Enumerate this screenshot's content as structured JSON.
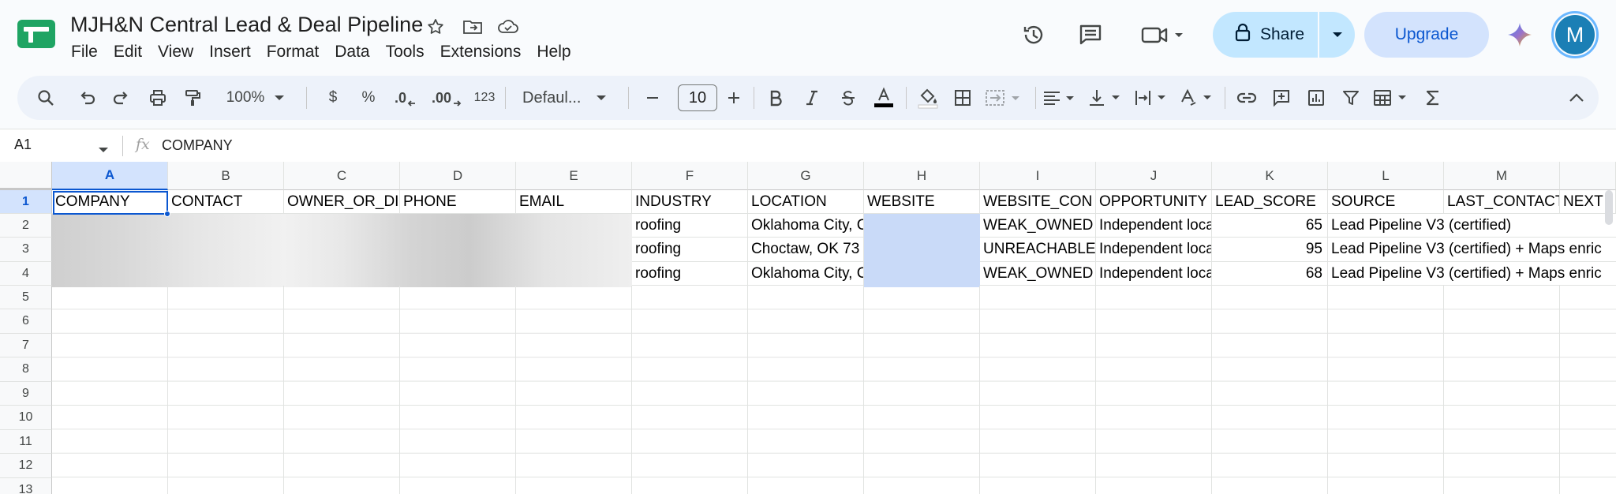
{
  "app": {
    "title": "MJH&N Central Lead & Deal Pipeline",
    "menu": [
      "File",
      "Edit",
      "View",
      "Insert",
      "Format",
      "Data",
      "Tools",
      "Extensions",
      "Help"
    ],
    "share_label": "Share",
    "upgrade_label": "Upgrade",
    "avatar_letter": "M"
  },
  "toolbar": {
    "zoom": "100%",
    "currency": "$",
    "percent": "%",
    "decrease_decimal": ".0",
    "increase_decimal": ".00",
    "number_format": "123",
    "font": "Defaul...",
    "font_size": "10"
  },
  "formula_bar": {
    "cell_ref": "A1",
    "fx": "fx",
    "content": "COMPANY"
  },
  "sheet": {
    "columns": [
      "A",
      "B",
      "C",
      "D",
      "E",
      "F",
      "G",
      "H",
      "I",
      "J",
      "K",
      "L",
      "M"
    ],
    "row_numbers": [
      "1",
      "2",
      "3",
      "4",
      "5",
      "6",
      "7",
      "8",
      "9",
      "10",
      "11",
      "12",
      "13"
    ],
    "header_row": [
      "COMPANY",
      "CONTACT",
      "OWNER_OR_DI",
      "PHONE",
      "EMAIL",
      "INDUSTRY",
      "LOCATION",
      "WEBSITE",
      "WEBSITE_CON",
      "OPPORTUNITY",
      "LEAD_SCORE",
      "SOURCE",
      "LAST_CONTACT",
      "NEXT"
    ],
    "rows": [
      {
        "industry": "roofing",
        "location": "Oklahoma City, C",
        "website_con": "WEAK_OWNED",
        "opportunity": "Independent loca",
        "lead_score": "65",
        "source": "Lead Pipeline V3 (certified)"
      },
      {
        "industry": "roofing",
        "location": "Choctaw, OK 73",
        "website_con": "UNREACHABLE",
        "opportunity": "Independent loca",
        "lead_score": "95",
        "source": "Lead Pipeline V3 (certified) + Maps enric"
      },
      {
        "industry": "roofing",
        "location": "Oklahoma City, C",
        "website_con": "WEAK_OWNED",
        "opportunity": "Independent loca",
        "lead_score": "68",
        "source": "Lead Pipeline V3 (certified) + Maps enric"
      }
    ]
  },
  "colors": {
    "accent": "#0b57d0",
    "share_bg": "#c2e7ff",
    "upgrade_bg": "#d3e3fd",
    "website_highlight": "#c9daf8"
  }
}
